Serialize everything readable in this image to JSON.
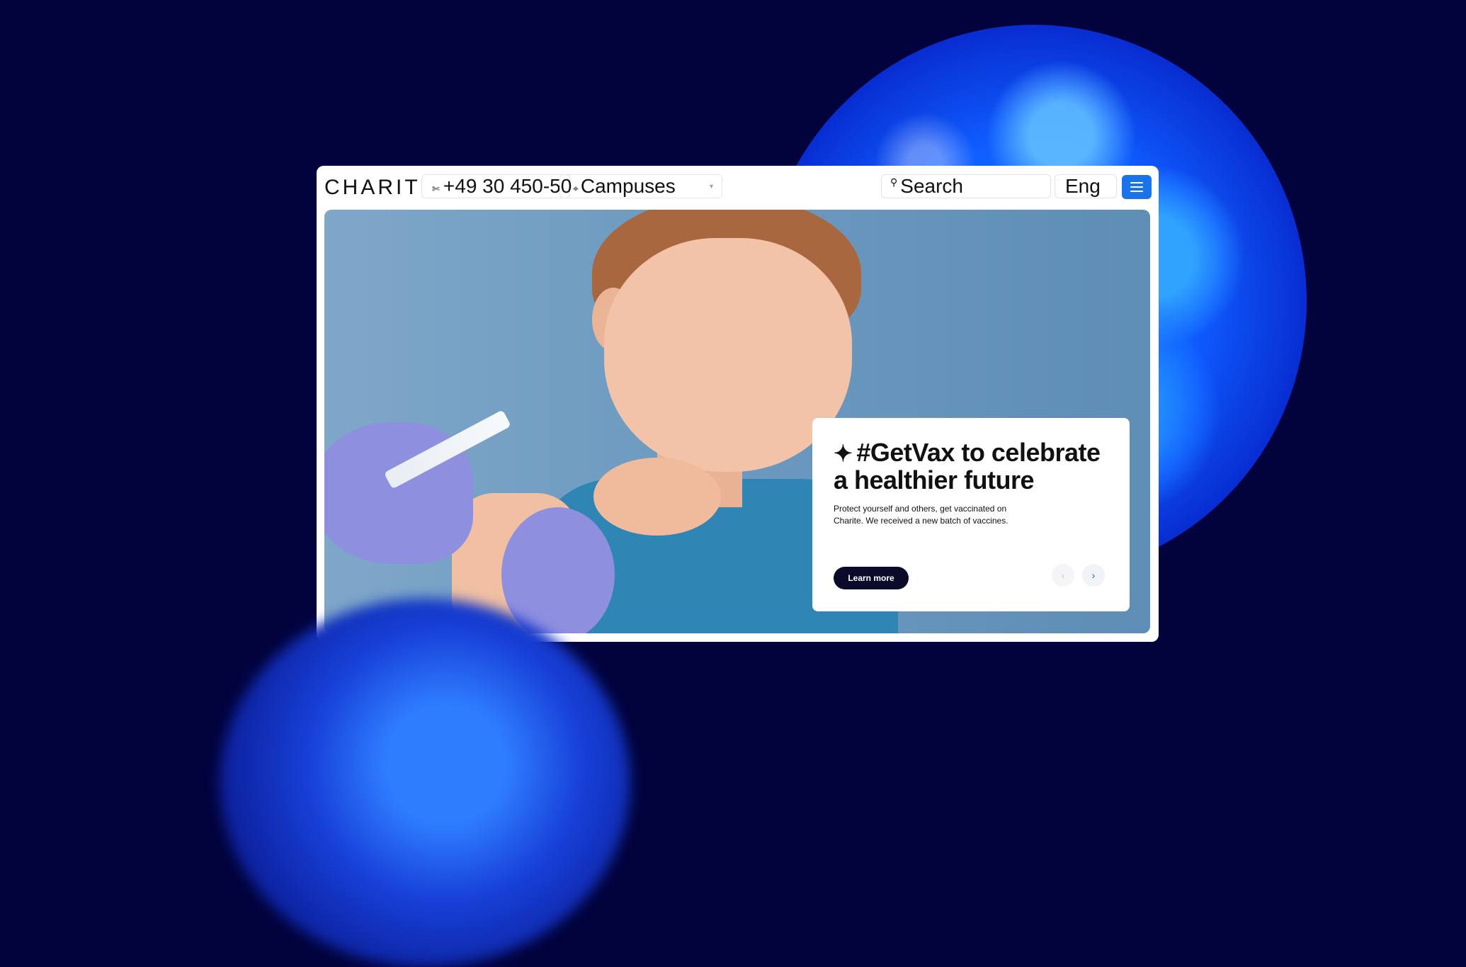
{
  "header": {
    "logo": "CHARITÉ",
    "phone": "+49 30 450-50",
    "campuses_label": "Campuses",
    "search_placeholder": "Search",
    "language": "Eng"
  },
  "hero": {
    "headline": "#GetVax to celebrate a healthier future",
    "description": "Protect yourself and others, get vaccinated on Charite. We received a new batch of vaccines.",
    "cta": "Learn more"
  },
  "icons": {
    "phone": "phone-icon",
    "location": "location-pin-icon",
    "search": "search-icon",
    "menu": "hamburger-menu-icon",
    "star": "sparkle-icon",
    "prev": "chevron-left-icon",
    "next": "chevron-right-icon"
  },
  "colors": {
    "background": "#02033d",
    "accent": "#1a73e8",
    "button_dark": "#0a0b2a"
  }
}
